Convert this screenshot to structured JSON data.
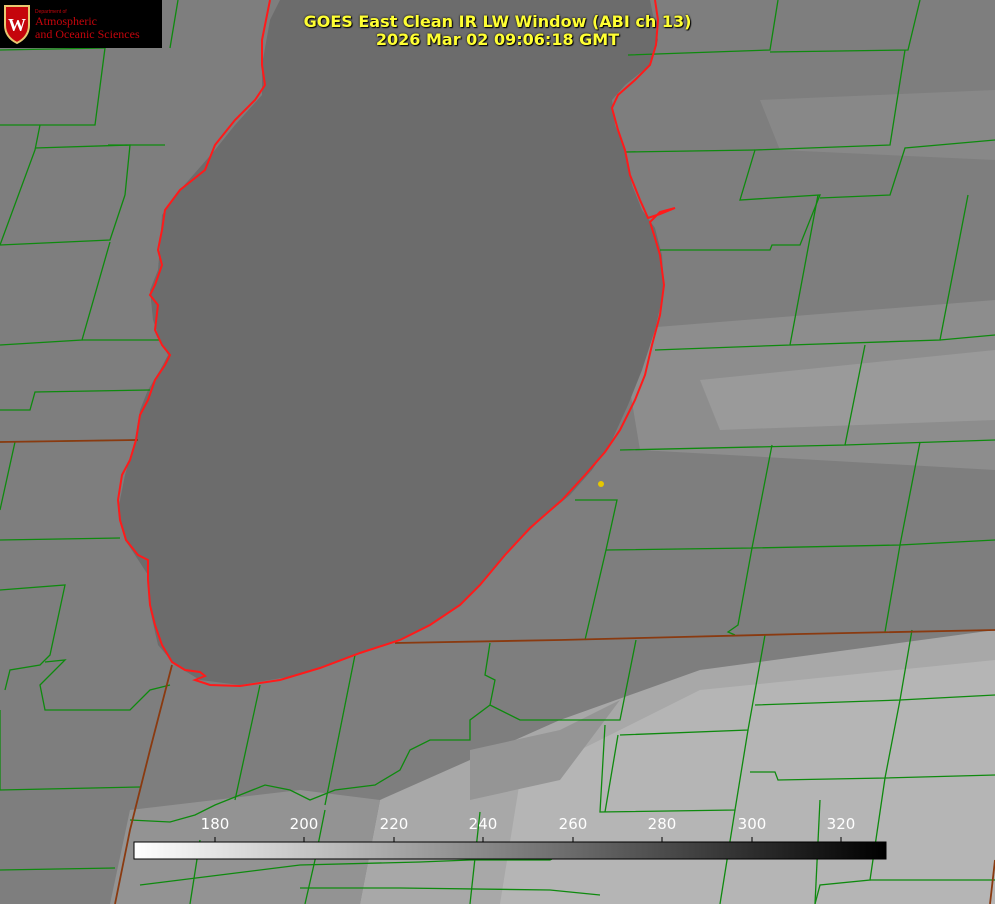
{
  "logo": {
    "department": "Department of",
    "line1": "Atmospheric",
    "line2": "and Oceanic Sciences",
    "crest_letter": "W",
    "icon": "uw-crest-icon"
  },
  "title": {
    "line1": "GOES East Clean IR LW Window (ABI ch 13)",
    "line2": "2026 Mar 02 09:06:18 GMT"
  },
  "colorbar": {
    "ticks": [
      "180",
      "200",
      "220",
      "240",
      "260",
      "280",
      "300",
      "320"
    ],
    "min": 163,
    "max": 330,
    "gradient": "white-to-black"
  },
  "colors": {
    "county_lines": "#0e8a0e",
    "state_lines": "#8a3a10",
    "shoreline": "#ff1a1a",
    "title_text": "#ffff33",
    "marker": "#e5c700"
  }
}
